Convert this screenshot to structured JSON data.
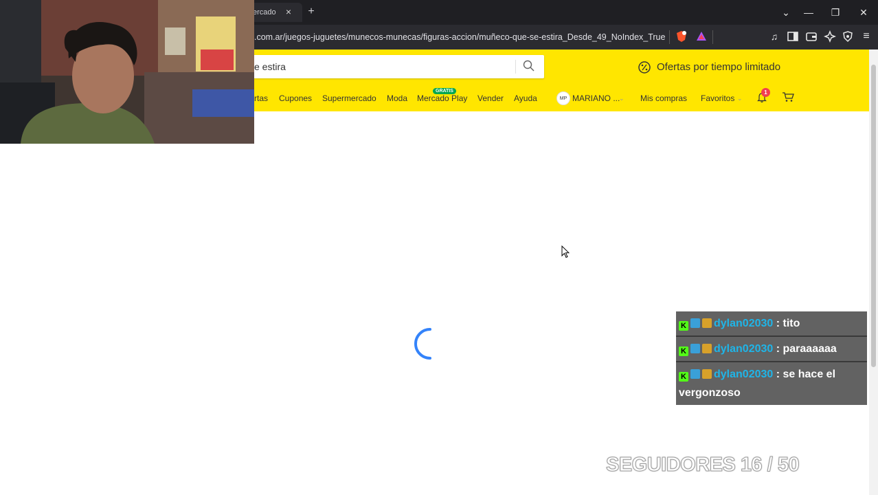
{
  "browser": {
    "tab_label": "ercado",
    "tab_close": "×",
    "new_tab": "+",
    "url": ".com.ar/juegos-juguetes/munecos-munecas/figuras-accion/muñeco-que-se-estira_Desde_49_NoIndex_True",
    "controls": {
      "dropdown": "⌄",
      "minimize": "—",
      "restore": "❐",
      "close": "✕"
    }
  },
  "site": {
    "search_value": "e estira",
    "offers_label": "Ofertas por tiempo limitado",
    "nav": {
      "ofertas": "rtas",
      "cupones": "Cupones",
      "supermercado": "Supermercado",
      "moda": "Moda",
      "mercado_play": "Mercado Play",
      "gratis_badge": "GRATIS",
      "vender": "Vender",
      "ayuda": "Ayuda"
    },
    "user": {
      "initials": "MP",
      "name": "MARIANO ...",
      "mis_compras": "Mis compras",
      "favoritos": "Favoritos",
      "notifications_count": "1"
    }
  },
  "chat": {
    "messages": [
      {
        "user": "dylan02030",
        "text": ": tito"
      },
      {
        "user": "dylan02030",
        "text": ": paraaaaaa"
      },
      {
        "user": "dylan02030",
        "text": ": se hace el vergonzoso"
      }
    ]
  },
  "overlay": {
    "followers_text": "SEGUIDORES 16 / 50"
  },
  "colors": {
    "brand_yellow": "#ffe600",
    "spinner_blue": "#3483fa",
    "chat_username": "#1fb5e8"
  }
}
